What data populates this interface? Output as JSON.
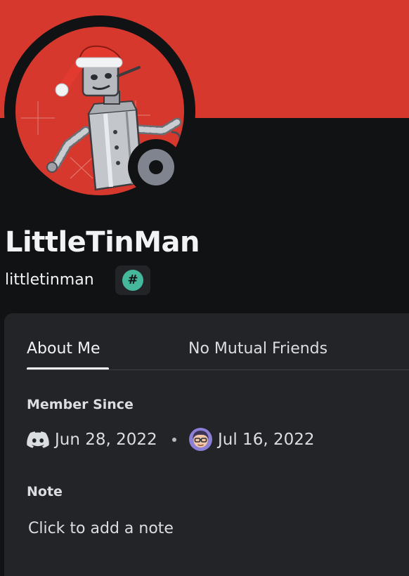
{
  "colors": {
    "banner": "#d6382d",
    "status_offline": "#80848e",
    "badge_accent": "#45b89c",
    "background": "#111214",
    "card": "#232428"
  },
  "profile": {
    "display_name": "LittleTinMan",
    "username": "littletinman",
    "avatar_icon": "tin-man-avatar",
    "status": "offline",
    "badge": {
      "symbol": "#",
      "icon": "hashtag-badge-icon"
    }
  },
  "tabs": [
    {
      "label": "About Me",
      "selected": true
    },
    {
      "label": "No Mutual Friends",
      "selected": false
    }
  ],
  "member_since": {
    "title": "Member Since",
    "discord_icon": "discord-icon",
    "discord_date": "Jun 28, 2022",
    "server_icon": "server-avatar-icon",
    "server_date": "Jul 16, 2022"
  },
  "note": {
    "title": "Note",
    "placeholder": "Click to add a note"
  }
}
